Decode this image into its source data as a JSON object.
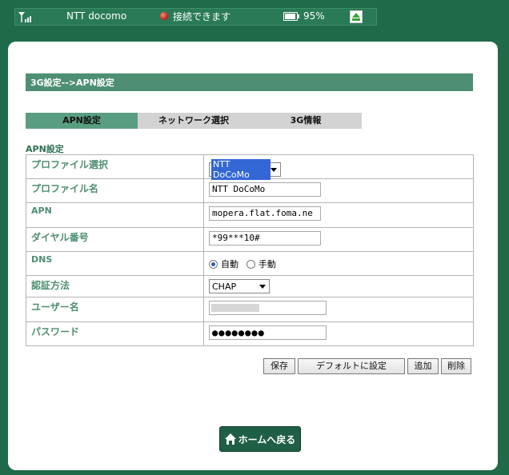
{
  "statusbar": {
    "signal_icon": "signal-bars-icon",
    "carrier": "NTT docomo",
    "connection_status": "接続できます",
    "connection_color": "#d02a1a",
    "battery_level": 0.95,
    "battery": "95%",
    "update_icon": "update-arrow-icon"
  },
  "breadcrumb": "3G設定-->APN設定",
  "tabs": [
    {
      "label": "APN設定",
      "active": true
    },
    {
      "label": "ネットワーク選択",
      "active": false
    },
    {
      "label": "3G情報",
      "active": false
    }
  ],
  "section_title": "APN設定",
  "form": {
    "profile_select": {
      "label": "プロファイル選択",
      "value": "NTT DoCoMo"
    },
    "profile_name": {
      "label": "プロファイル名",
      "value": "NTT DoCoMo"
    },
    "apn": {
      "label": "APN",
      "value": "mopera.flat.foma.ne"
    },
    "dial_number": {
      "label": "ダイヤル番号",
      "value": "*99***10#"
    },
    "dns": {
      "label": "DNS",
      "options": [
        "自動",
        "手動"
      ],
      "selected": "自動"
    },
    "auth_method": {
      "label": "認証方法",
      "value": "CHAP"
    },
    "username": {
      "label": "ユーザー名",
      "value": ""
    },
    "password": {
      "label": "パスワード",
      "value": "●●●●●●●●"
    }
  },
  "buttons": {
    "save": "保存",
    "set_default": "デフォルトに設定",
    "add": "追加",
    "delete": "削除"
  },
  "home_button": {
    "label": "ホームへ戻る",
    "icon": "home-icon"
  },
  "colors": {
    "background": "#1f6b49",
    "header_bar": "#4e8f73",
    "active_tab": "#5a9e82",
    "label_text": "#4f8f73"
  }
}
